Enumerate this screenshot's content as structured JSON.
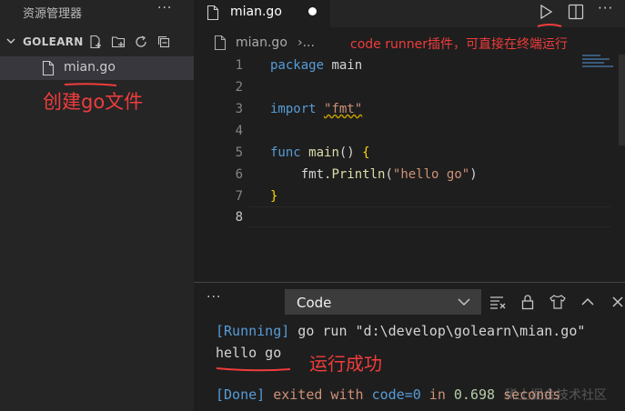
{
  "sidebar": {
    "title": "资源管理器",
    "more": "···",
    "folder_name": "GOLEARN",
    "file_name": "mian.go"
  },
  "editor": {
    "tab_label": "mian.go",
    "breadcrumb_file": "mian.go",
    "breadcrumb_sep": "›...",
    "more": "···",
    "line_numbers": [
      "1",
      "2",
      "3",
      "4",
      "5",
      "6",
      "7",
      "8"
    ]
  },
  "code": {
    "l1_kw": "package",
    "l1_name": " main",
    "l3_kw": "import",
    "l3_str": "\"fmt\"",
    "l5_kw": "func",
    "l5_fn": "main",
    "l5_rest": "() ",
    "l5_brace": "{",
    "l6_indent": "    fmt.",
    "l6_fn": "Println",
    "l6_open": "(",
    "l6_str": "\"hello go\"",
    "l6_close": ")",
    "l7_brace": "}"
  },
  "panel": {
    "more": "···",
    "select_value": "Code",
    "out_running_tag": "[Running]",
    "out_running_cmd": " go run \"d:\\develop\\golearn\\mian.go\"",
    "out_result": "hello go",
    "out_done_tag": "[Done]",
    "out_done_text": " exited with ",
    "out_done_code": "code=0",
    "out_done_in": " in ",
    "out_done_time": "0.698",
    "out_done_seconds": " seconds"
  },
  "annotations": {
    "create_file": "创建go文件",
    "code_runner": "code runner插件，可直接在终端运行",
    "run_success": "运行成功",
    "watermark": "稀土掘金技术社区"
  },
  "colors": {
    "annotation_red": "#f03c3c",
    "keyword_blue": "#569cd6",
    "string_orange": "#ce9178",
    "function_yellow": "#dcdcaa",
    "number_green": "#b5cea8"
  }
}
